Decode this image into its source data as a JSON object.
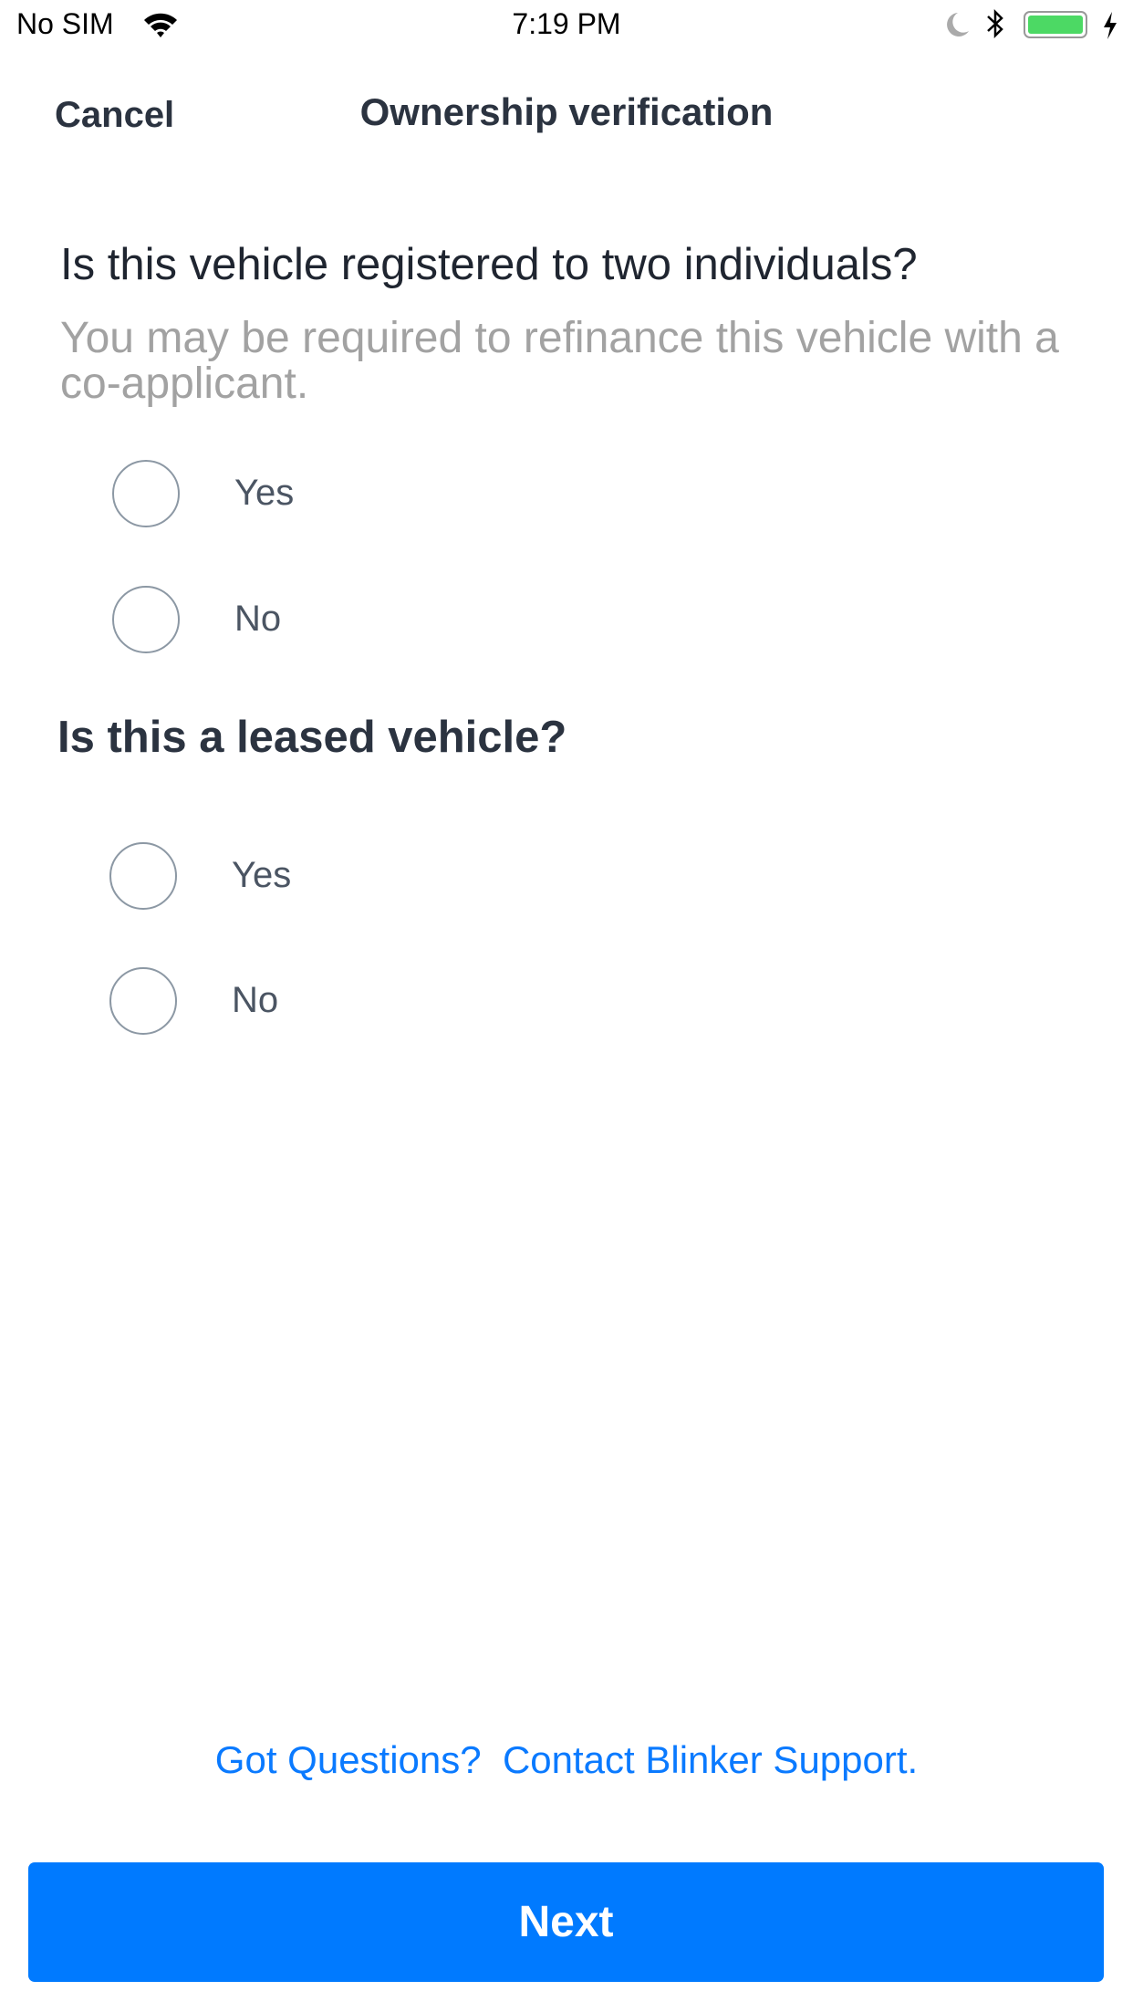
{
  "status_bar": {
    "carrier": "No SIM",
    "time": "7:19 PM",
    "battery_color": "#4cd964"
  },
  "nav": {
    "cancel_label": "Cancel",
    "title": "Ownership verification"
  },
  "questions": [
    {
      "title": "Is this vehicle registered to two individuals?",
      "subtitle": "You may be required to refinance this vehicle with a co-applicant.",
      "options": [
        {
          "label": "Yes",
          "selected": false
        },
        {
          "label": "No",
          "selected": false
        }
      ]
    },
    {
      "title": "Is this a leased vehicle?",
      "options": [
        {
          "label": "Yes",
          "selected": false
        },
        {
          "label": "No",
          "selected": false
        }
      ]
    }
  ],
  "footer": {
    "questions_link": "Got Questions?",
    "support_link": "Contact Blinker Support.",
    "next_label": "Next"
  },
  "colors": {
    "accent": "#007aff",
    "text": "#2b3340",
    "muted": "#a2a2a2"
  }
}
